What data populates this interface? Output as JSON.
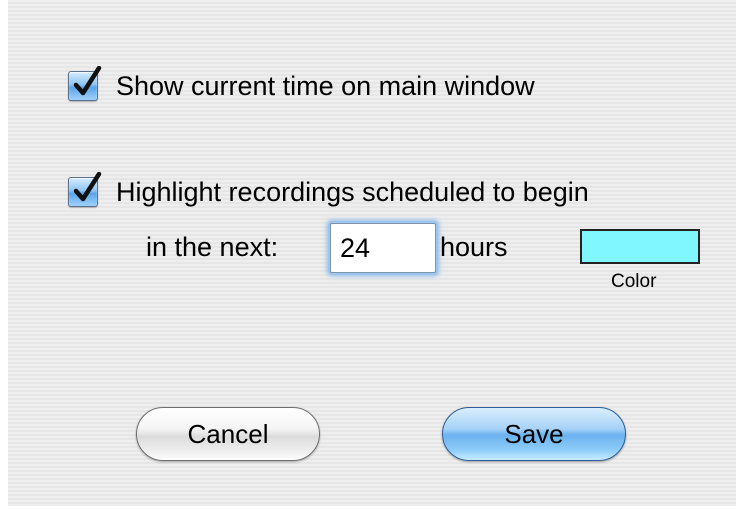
{
  "options": {
    "show_time": {
      "label": "Show current time on main window",
      "checked": true
    },
    "highlight": {
      "label": "Highlight recordings scheduled to begin",
      "checked": true,
      "prefix": "in the next:",
      "hours_value": "24",
      "unit": "hours",
      "color_label": "Color",
      "color": "#80f6ff"
    }
  },
  "buttons": {
    "cancel": "Cancel",
    "save": "Save"
  },
  "icons": {
    "checkmark": "check-icon"
  }
}
